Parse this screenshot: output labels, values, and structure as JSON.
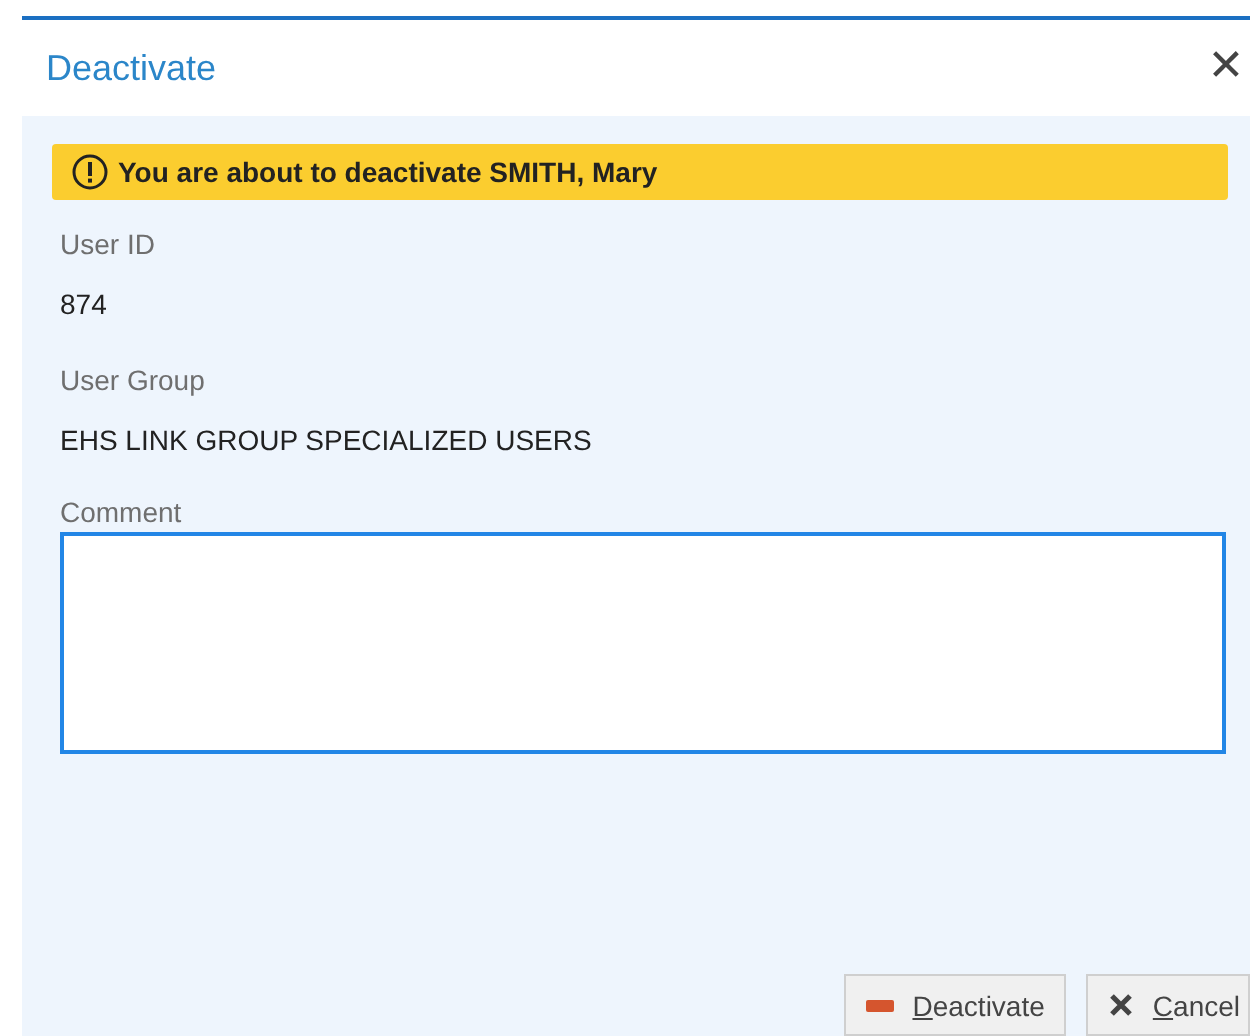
{
  "dialog": {
    "title": "Deactivate",
    "close": "✕"
  },
  "banner": {
    "kind": "warning",
    "text": "You are about to deactivate SMITH, Mary"
  },
  "fields": [
    {
      "label": "User ID",
      "value": "874"
    },
    {
      "label": "User Group",
      "value": "EHS LINK GROUP SPECIALIZED USERS"
    }
  ],
  "comment": {
    "label": "Comment",
    "focused": true
  },
  "buttons": [
    {
      "kind": "deactivate",
      "access_key": "D",
      "label_rest": "eactivate"
    },
    {
      "kind": "cancel",
      "access_key": "C",
      "label_rest": "ancel"
    }
  ]
}
